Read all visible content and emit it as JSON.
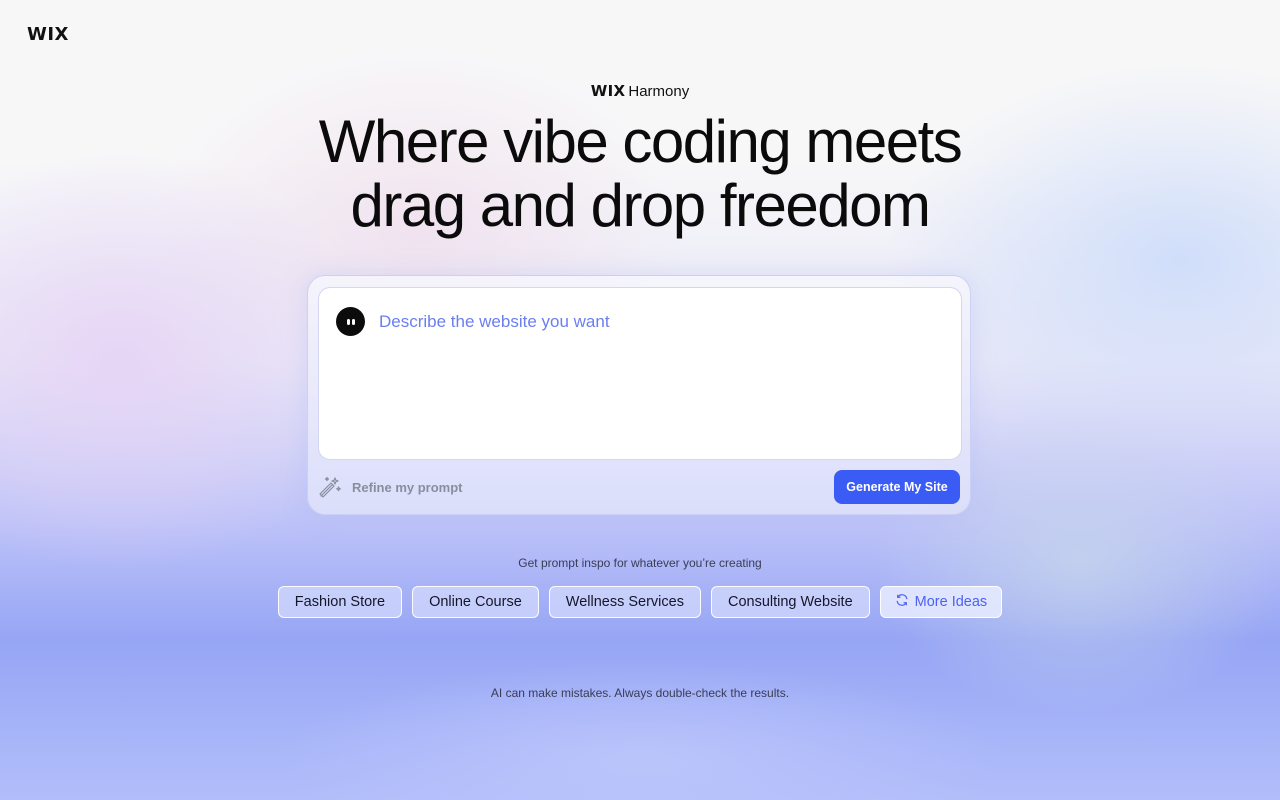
{
  "header": {
    "logo_text": "WIX"
  },
  "brand": {
    "name": "WIX",
    "product": "Harmony"
  },
  "headline": {
    "line1": "Where vibe coding meets",
    "line2": "drag and drop freedom"
  },
  "prompt": {
    "placeholder": "Describe the website you want",
    "value": "",
    "refine_label": "Refine my prompt",
    "refine_icon": "magic-wand-icon",
    "avatar_icon": "assistant-avatar-icon",
    "generate_label": "Generate My Site"
  },
  "inspo": {
    "label": "Get prompt inspo for whatever you’re creating",
    "chips": [
      "Fashion Store",
      "Online Course",
      "Wellness Services",
      "Consulting Website"
    ],
    "more_label": "More Ideas",
    "more_icon": "refresh-icon"
  },
  "footer": {
    "disclaimer": "AI can make mistakes. Always double-check the results."
  },
  "colors": {
    "accent": "#3b5bf5",
    "placeholder": "#6b7ef0",
    "more_ideas": "#4c62f2"
  }
}
